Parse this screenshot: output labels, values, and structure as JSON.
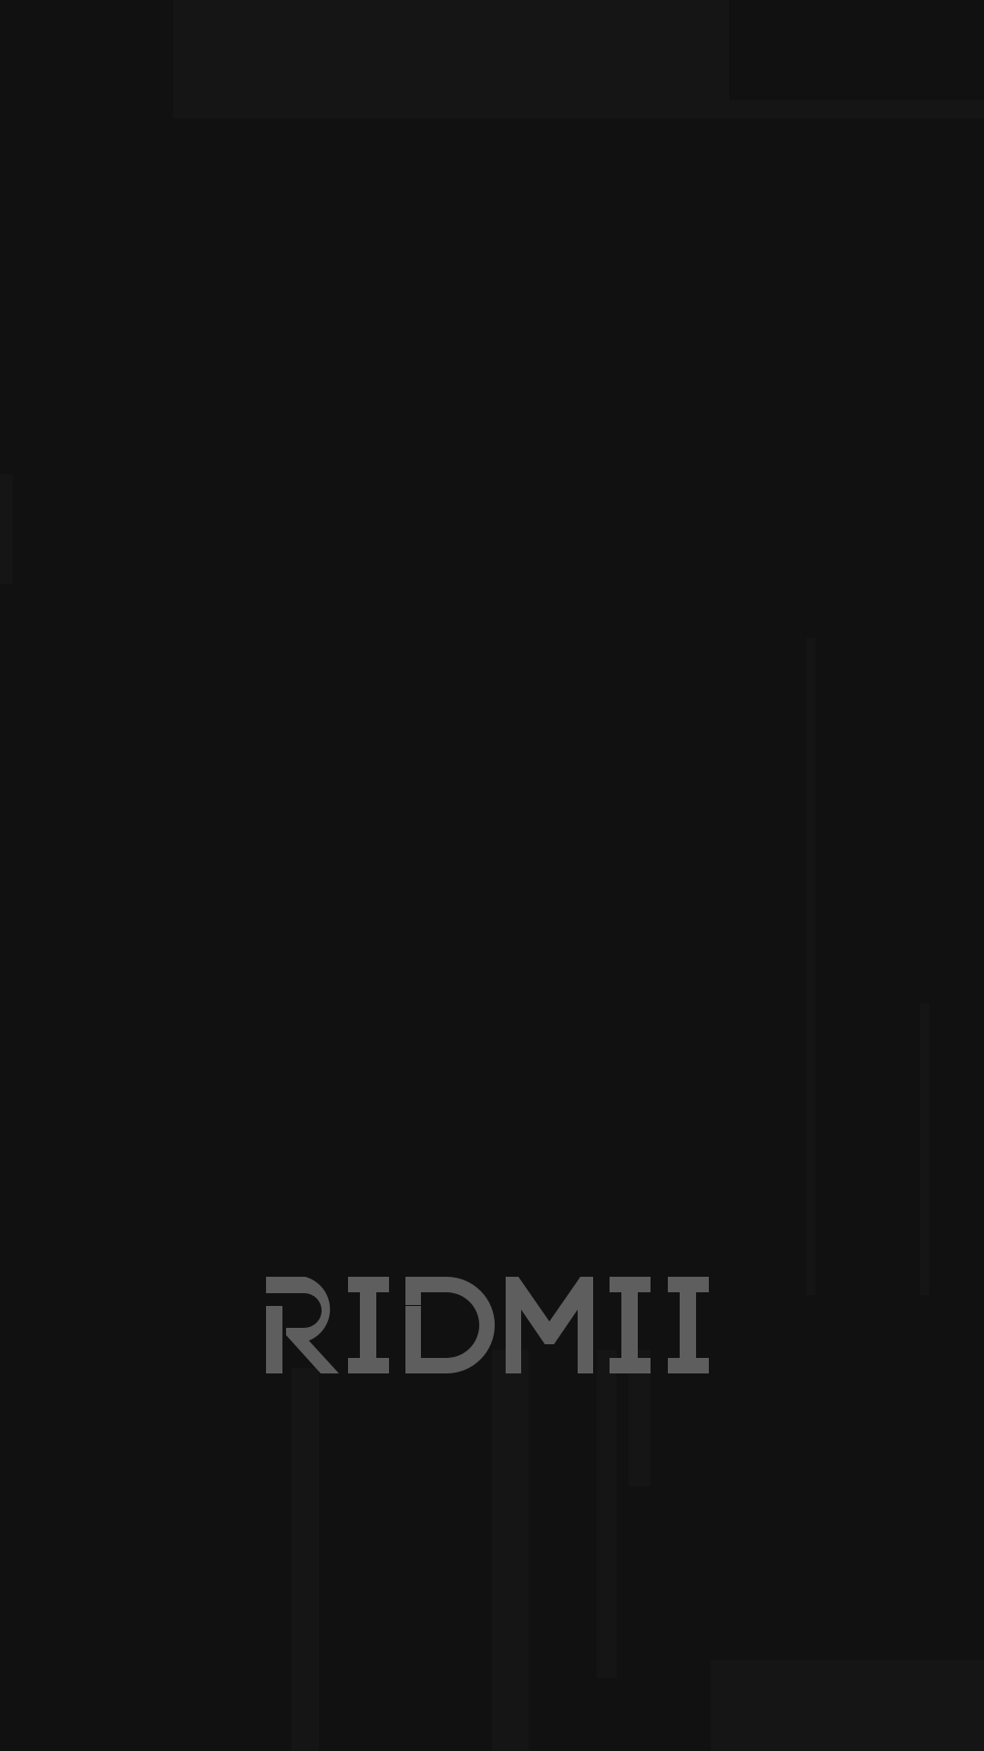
{
  "splash": {
    "brand_name": "RIDMII",
    "logo_icon": "ridmii-wordmark-logo",
    "colors": {
      "background": "#111111",
      "logo": "#5e5e5e"
    }
  }
}
